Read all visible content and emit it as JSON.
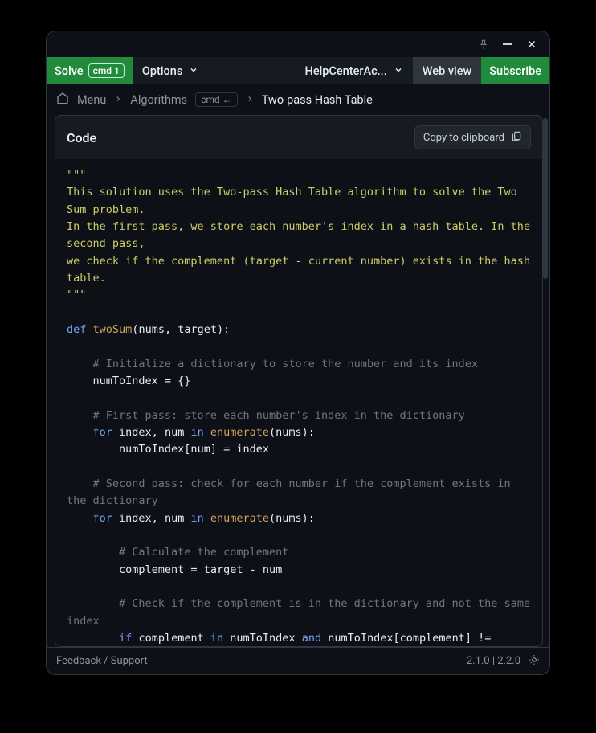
{
  "titlebar": {
    "pin": "pin",
    "minimize": "minimize",
    "close": "close"
  },
  "topbar": {
    "solve": "Solve",
    "solve_cmd": "cmd 1",
    "options": "Options",
    "help": "HelpCenterAc...",
    "webview": "Web view",
    "subscribe": "Subscribe"
  },
  "breadcrumb": {
    "menu": "Menu",
    "algorithms": "Algorithms",
    "cmd_back": "cmd ←",
    "current": "Two-pass Hash Table"
  },
  "card": {
    "title": "Code",
    "copy": "Copy to clipboard"
  },
  "code": {
    "docstring_open": "\"\"\"",
    "docstring_l1": "This solution uses the Two-pass Hash Table algorithm to solve the Two Sum problem.",
    "docstring_l2": "In the first pass, we store each number's index in a hash table. In the second pass,",
    "docstring_l3": "we check if the complement (target - current number) exists in the hash table.",
    "docstring_close": "\"\"\"",
    "def": "def",
    "fn": "twoSum",
    "sig": "(nums, target):",
    "c1": "# Initialize a dictionary to store the number and its index",
    "l1": "numToIndex = {}",
    "c2": "# First pass: store each number's index in the dictionary",
    "for": "for",
    "in": "in",
    "enum": "enumerate",
    "loop_vars": "index, num",
    "loop_tail": "(nums):",
    "l2": "numToIndex[num] = index",
    "c3": "# Second pass: check for each number if the complement exists in the dictionary",
    "c4": "# Calculate the complement",
    "l3": "complement = target - num",
    "c5": "# Check if the complement is in the dictionary and not the same index",
    "if": "if",
    "and": "and",
    "l4a": "complement",
    "l4b": "numToIndex",
    "l4c": "numToIndex[complement] !="
  },
  "footer": {
    "feedback": "Feedback / Support",
    "version": "2.1.0 | 2.2.0"
  }
}
